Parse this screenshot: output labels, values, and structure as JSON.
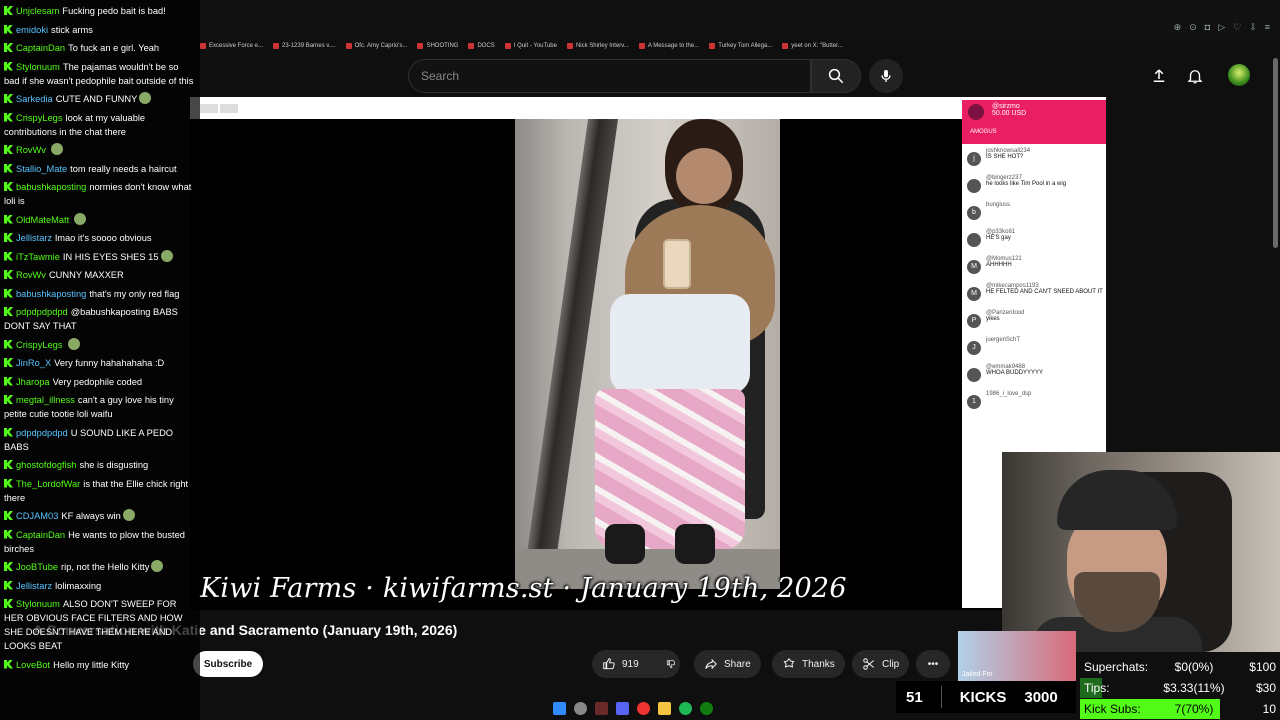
{
  "browser": {
    "bookmarks": [
      "Excessive Force e...",
      "23-1239 Barnes v....",
      "Ofc. Amy Caprio's...",
      "SHOOTING",
      "DOCS",
      "I Quit - YouTube",
      "Nick Shirley Interv...",
      "A Message to the...",
      "Turkey Tom Allega...",
      "yeet on X: \"Butter..."
    ]
  },
  "youtube": {
    "search_placeholder": "Search",
    "video_title": "A Conversation with Katie and Sacramento (January 19th, 2026)",
    "subscribe_label": "Subscribe",
    "like_count": "919",
    "share_label": "Share",
    "thanks_label": "Thanks",
    "clip_label": "Clip",
    "more_label": "•••"
  },
  "video": {
    "watermark": "Kiwi Farms · kiwifarms.st · January 19th, 2026",
    "superchat": {
      "user": "@sirzmo",
      "amount": "50.00 USD",
      "message": "AMOGUS"
    },
    "side_chat": [
      {
        "initial": "j",
        "user": "joshknowsall234",
        "message": "IS SHE HOT?"
      },
      {
        "initial": "",
        "user": "@bingerz237",
        "message": "he looks like Tim Pool in a wig"
      },
      {
        "initial": "b",
        "user": "bungluss",
        "message": ""
      },
      {
        "initial": "",
        "user": "@p33ko81",
        "message": "HE'S gay"
      },
      {
        "initial": "M",
        "user": "@Momus121",
        "message": "AHHHHH"
      },
      {
        "initial": "M",
        "user": "@mikecampos1193",
        "message": "HE FELTED AND CAN'T SNEED ABOUT IT"
      },
      {
        "initial": "P",
        "user": "@Panzerdood",
        "message": "yikes"
      },
      {
        "initial": "J",
        "user": "juergenSchT",
        "message": ""
      },
      {
        "initial": "",
        "user": "@emmak9488",
        "message": "WHOA BUDDYYYYY"
      },
      {
        "initial": "1",
        "user": "1986_i_love_dsp",
        "message": ""
      }
    ]
  },
  "chat": [
    {
      "user": "Unjclesam",
      "message": "Fucking pedo bait is bad!",
      "emote": false
    },
    {
      "user": "emidoki",
      "message": "stick arms",
      "emote": false
    },
    {
      "user": "CaptainDan",
      "message": "To fuck an e girl. Yeah",
      "emote": false
    },
    {
      "user": "Stylonuum",
      "message": "The pajamas wouldn't be so bad if she wasn't pedophile bait outside of this",
      "emote": false
    },
    {
      "user": "Sarkedia",
      "message": "CUTE AND FUNNY",
      "emote": true
    },
    {
      "user": "CrispyLegs",
      "message": "look at my valuable contributions in the chat there",
      "emote": false
    },
    {
      "user": "RovWv",
      "message": "",
      "emote": true
    },
    {
      "user": "Stallio_Mate",
      "message": "tom really needs a haircut",
      "emote": false
    },
    {
      "user": "babushkaposting",
      "message": "normies don't know what loli is",
      "emote": false
    },
    {
      "user": "OldMateMatt",
      "message": "",
      "emote": true
    },
    {
      "user": "Jellistarz",
      "message": "lmao it's soooo obvious",
      "emote": false
    },
    {
      "user": "iTzTawmie",
      "message": "IN HIS EYES SHES 15",
      "emote": true
    },
    {
      "user": "RovWv",
      "message": "CUNNY MAXXER",
      "emote": false
    },
    {
      "user": "babushkaposting",
      "message": "that's my only red flag",
      "emote": false
    },
    {
      "user": "pdpdpdpdpd",
      "message": "@babushkaposting BABS DONT SAY THAT",
      "emote": false
    },
    {
      "user": "CrispyLegs",
      "message": "",
      "emote": true
    },
    {
      "user": "JinRo_X",
      "message": "Very funny hahahahaha :D",
      "emote": false
    },
    {
      "user": "Jharopa",
      "message": "Very pedophile coded",
      "emote": false
    },
    {
      "user": "megtal_illness",
      "message": "can't a guy love his tiny petite cutie tootie loli waifu",
      "emote": false
    },
    {
      "user": "pdpdpdpdpd",
      "message": "U SOUND LIKE A PEDO BABS",
      "emote": false
    },
    {
      "user": "ghostofdogfish",
      "message": "she is disgusting",
      "emote": false
    },
    {
      "user": "The_LordofWar",
      "message": "is that the Ellie chick right there",
      "emote": false
    },
    {
      "user": "CDJAM03",
      "message": "KF always win",
      "emote": true
    },
    {
      "user": "CaptainDan",
      "message": "He wants to plow the busted birches",
      "emote": false
    },
    {
      "user": "JooBTube",
      "message": "rip, not the Hello Kitty",
      "emote": true
    },
    {
      "user": "Jellistarz",
      "message": "lolimaxxing",
      "emote": false
    },
    {
      "user": "Stylonuum",
      "message": "ALSO DON'T SWEEP FOR HER OBVIOUS FACE FILTERS AND HOW SHE DOESN'T HAVE THEM HERE AND LOOKS BEAT",
      "emote": false
    },
    {
      "user": "LoveBot",
      "message": "Hello my little Kitty",
      "emote": false
    }
  ],
  "stream_stats": {
    "kicks_count": "51",
    "kicks_label": "KICKS",
    "kicks_goal": "3000",
    "superchats_label": "Superchats:",
    "superchats_value": "$0(0%)",
    "superchats_goal": "$100",
    "tips_label": "Tips:",
    "tips_value": "$3.33(11%)",
    "tips_goal": "$30",
    "tips_progress": 0.11,
    "subs_label": "Kick Subs:",
    "subs_value": "7(70%)",
    "subs_goal": "10",
    "subs_progress": 0.7,
    "jailed_text": "Jailed For"
  },
  "colors": {
    "kick_green": "#53fc18",
    "superchat_pink": "#e91e63",
    "yt_dark": "#0f0f0f"
  }
}
